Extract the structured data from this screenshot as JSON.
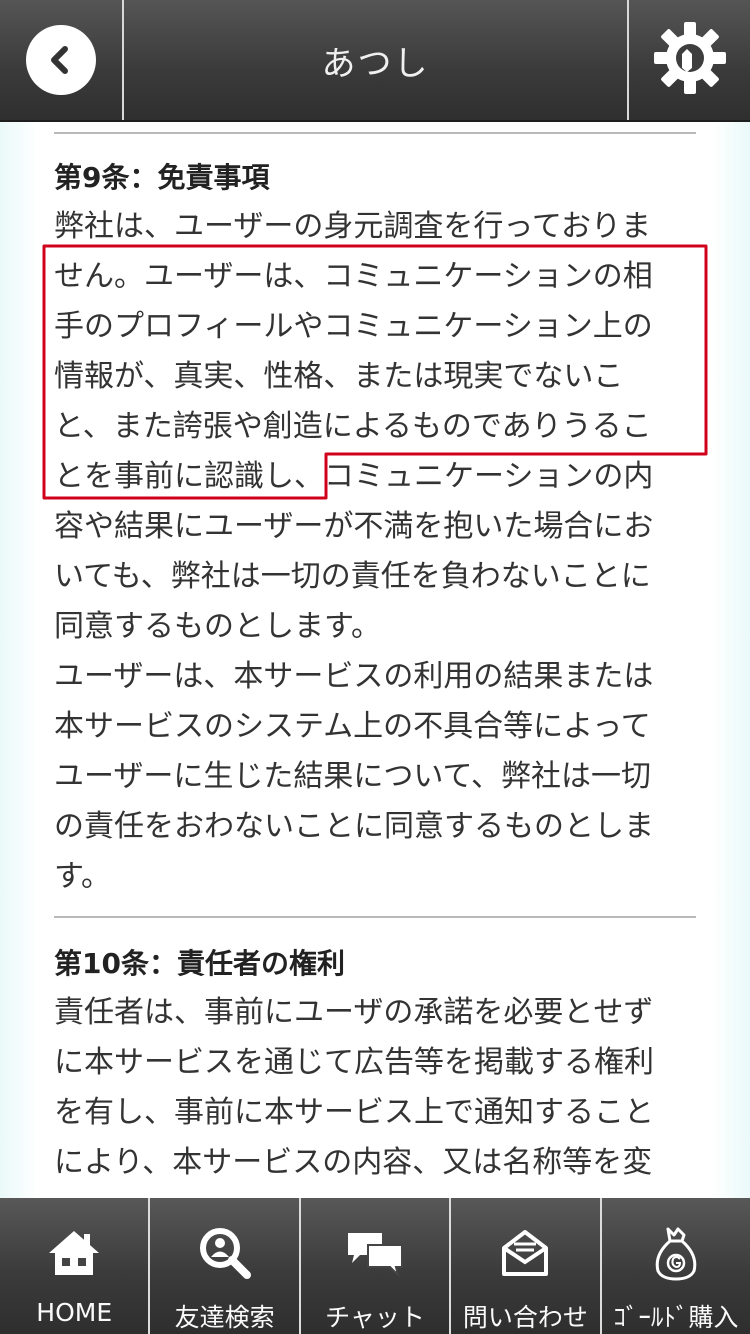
{
  "header": {
    "title": "あつし"
  },
  "sections": [
    {
      "title": "第9条：免責事項",
      "lines": [
        "弊社は、ユーザーの身元調査を行っておりま",
        "せん。ユーザーは、コミュニケーションの相",
        "手のプロフィールやコミュニケーション上の",
        "情報が、真実、性格、または現実でないこ",
        "と、また誇張や創造によるものでありうるこ",
        "とを事前に認識し、コミュニケーションの内",
        "容や結果にユーザーが不満を抱いた場合にお",
        "いても、弊社は一切の責任を負わないことに",
        "同意するものとします。",
        "ユーザーは、本サービスの利用の結果または",
        "本サービスのシステム上の不具合等によって",
        "ユーザーに生じた結果について、弊社は一切",
        "の責任をおわないことに同意するものとしま",
        "す。"
      ]
    },
    {
      "title": "第10条：責任者の権利",
      "lines": [
        "責任者は、事前にユーザの承諾を必要とせず",
        "に本サービスを通じて広告等を掲載する権利",
        "を有し、事前に本サービス上で通知すること",
        "により、本サービスの内容、又は名称等を変"
      ]
    }
  ],
  "nav": [
    {
      "label": "HOME",
      "icon": "home-icon"
    },
    {
      "label": "友達検索",
      "icon": "search-user-icon"
    },
    {
      "label": "チャット",
      "icon": "chat-icon"
    },
    {
      "label": "問い合わせ",
      "icon": "mail-icon"
    },
    {
      "label": "ｺﾞｰﾙﾄﾞ購入",
      "icon": "gold-bag-icon"
    }
  ],
  "colors": {
    "highlight": "#d0021b",
    "header": "#3a3a3a"
  }
}
